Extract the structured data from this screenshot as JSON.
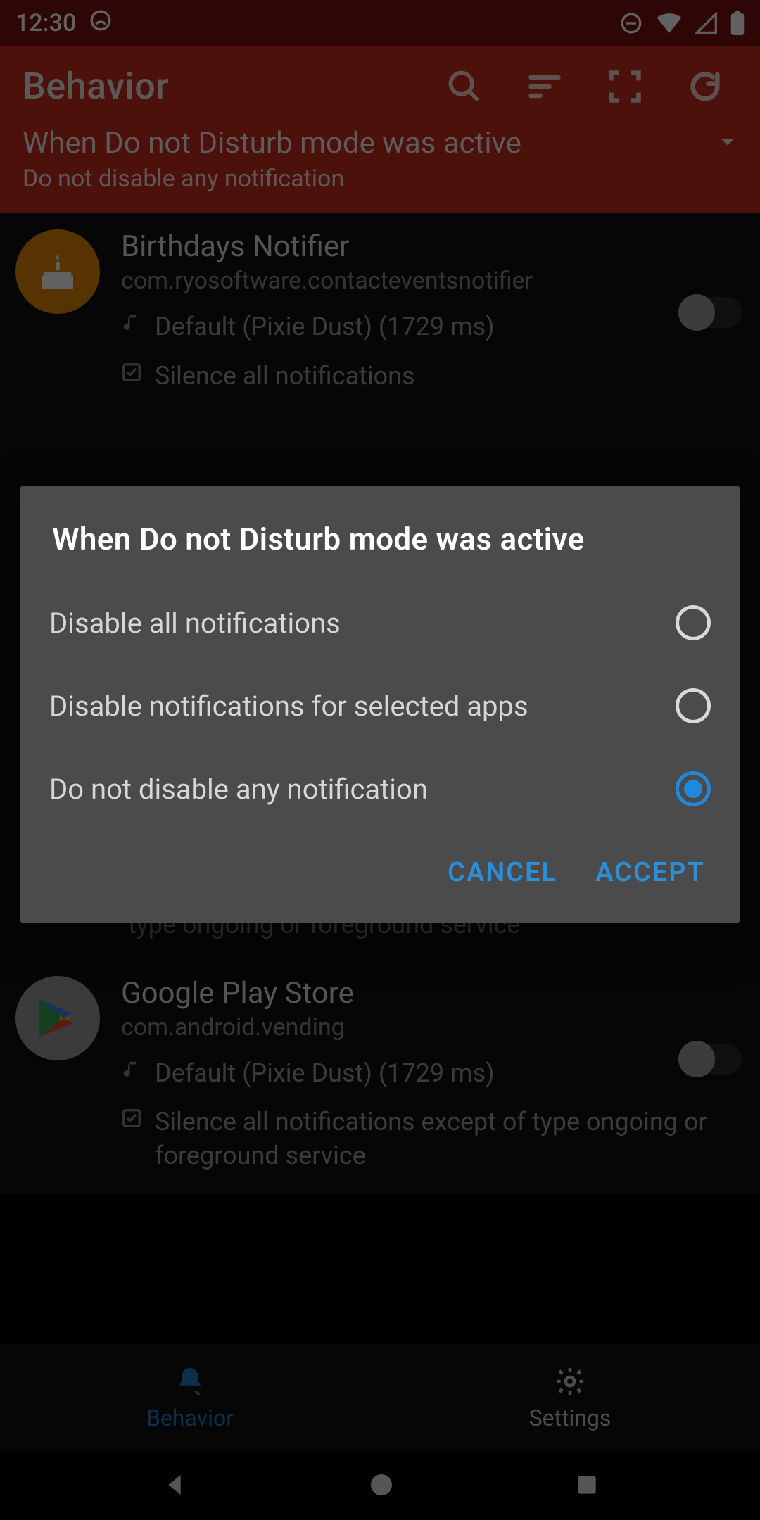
{
  "status": {
    "time": "12:30"
  },
  "appbar": {
    "title": "Behavior"
  },
  "subheader": {
    "title": "When Do not Disturb mode was active",
    "subtitle": "Do not disable any notification"
  },
  "apps": [
    {
      "name": "Birthdays Notifier",
      "pkg": "com.ryosoftware.contacteventsnotifier",
      "sound": "Default (Pixie Dust) (1729 ms)",
      "silence": "Silence all notifications"
    },
    {
      "name": "Google Play Store",
      "pkg": "com.android.vending",
      "sound": "Default (Pixie Dust) (1729 ms)",
      "silence": "Silence all notifications except of type ongoing or foreground service"
    }
  ],
  "hidden_line": "type ongoing or foreground service",
  "bottomnav": {
    "behavior": "Behavior",
    "settings": "Settings"
  },
  "dialog": {
    "title": "When Do not Disturb mode was active",
    "options": [
      "Disable all notifications",
      "Disable notifications for selected apps",
      "Do not disable any notification"
    ],
    "cancel": "CANCEL",
    "accept": "ACCEPT",
    "selected_index": 2
  }
}
